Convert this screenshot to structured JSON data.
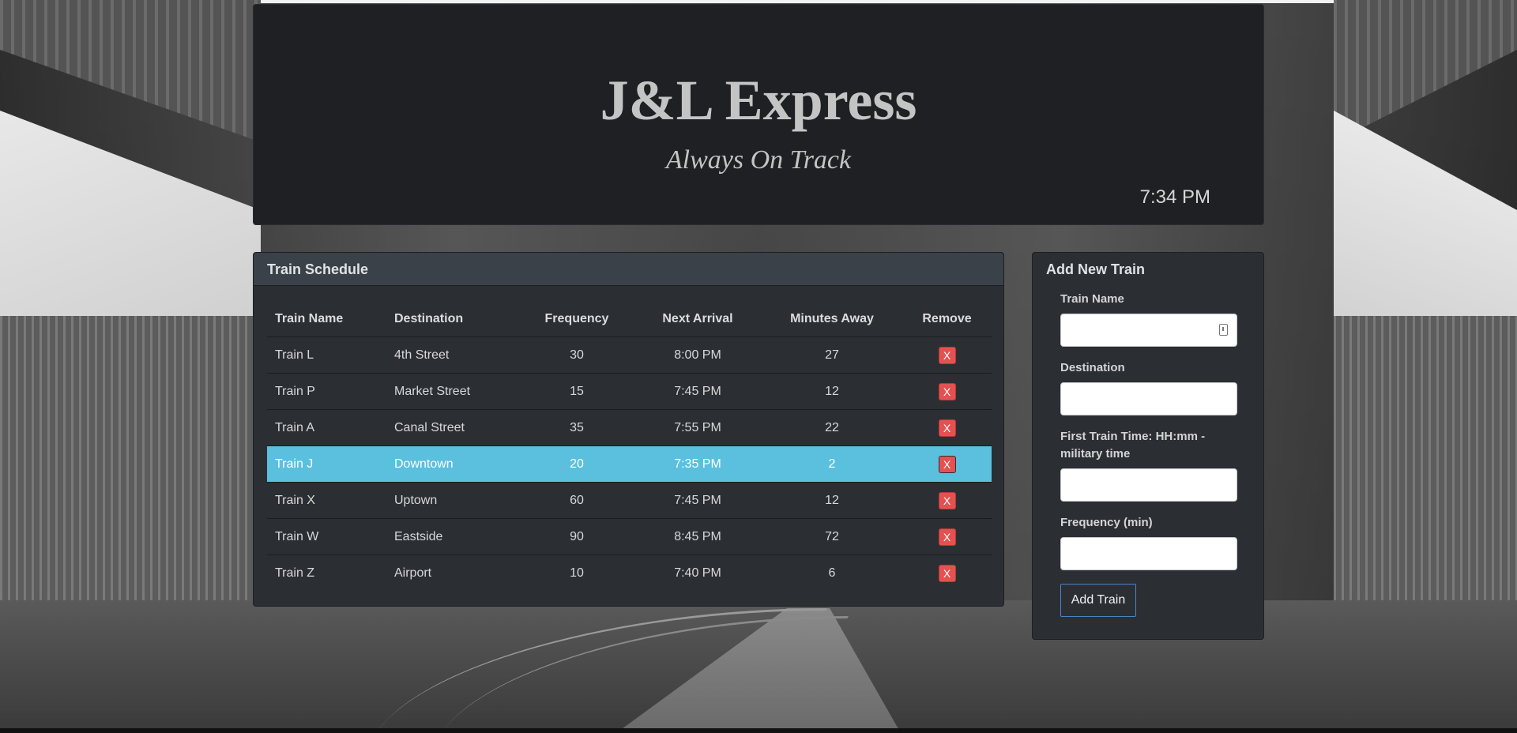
{
  "header": {
    "title": "J&L Express",
    "subtitle": "Always On Track",
    "clock": "7:34 PM"
  },
  "schedule": {
    "heading": "Train Schedule",
    "columns": [
      "Train Name",
      "Destination",
      "Frequency",
      "Next Arrival",
      "Minutes Away",
      "Remove"
    ],
    "rows": [
      {
        "name": "Train L",
        "destination": "4th Street",
        "frequency": "30",
        "next_arrival": "8:00 PM",
        "minutes_away": "27",
        "remove": "X"
      },
      {
        "name": "Train P",
        "destination": "Market Street",
        "frequency": "15",
        "next_arrival": "7:45 PM",
        "minutes_away": "12",
        "remove": "X"
      },
      {
        "name": "Train A",
        "destination": "Canal Street",
        "frequency": "35",
        "next_arrival": "7:55 PM",
        "minutes_away": "22",
        "remove": "X"
      },
      {
        "name": "Train J",
        "destination": "Downtown",
        "frequency": "20",
        "next_arrival": "7:35 PM",
        "minutes_away": "2",
        "remove": "X"
      },
      {
        "name": "Train X",
        "destination": "Uptown",
        "frequency": "60",
        "next_arrival": "7:45 PM",
        "minutes_away": "12",
        "remove": "X"
      },
      {
        "name": "Train W",
        "destination": "Eastside",
        "frequency": "90",
        "next_arrival": "8:45 PM",
        "minutes_away": "72",
        "remove": "X"
      },
      {
        "name": "Train Z",
        "destination": "Airport",
        "frequency": "10",
        "next_arrival": "7:40 PM",
        "minutes_away": "6",
        "remove": "X"
      }
    ],
    "highlight_color": "#5bc0de"
  },
  "add_train": {
    "heading": "Add New Train",
    "fields": {
      "train_name": {
        "label": "Train Name",
        "value": ""
      },
      "destination": {
        "label": "Destination",
        "value": ""
      },
      "first_train_time": {
        "label": "First Train Time: HH:mm - military time",
        "value": ""
      },
      "frequency": {
        "label": "Frequency (min)",
        "value": ""
      }
    },
    "submit_label": "Add Train"
  },
  "colors": {
    "panel_bg": "#2b2f34",
    "header_bg": "#1e2023",
    "remove_button": "#e45151",
    "submit_border": "#4a86c6"
  },
  "icons": {
    "autofill": "contact-card-icon",
    "remove": "close-icon"
  }
}
